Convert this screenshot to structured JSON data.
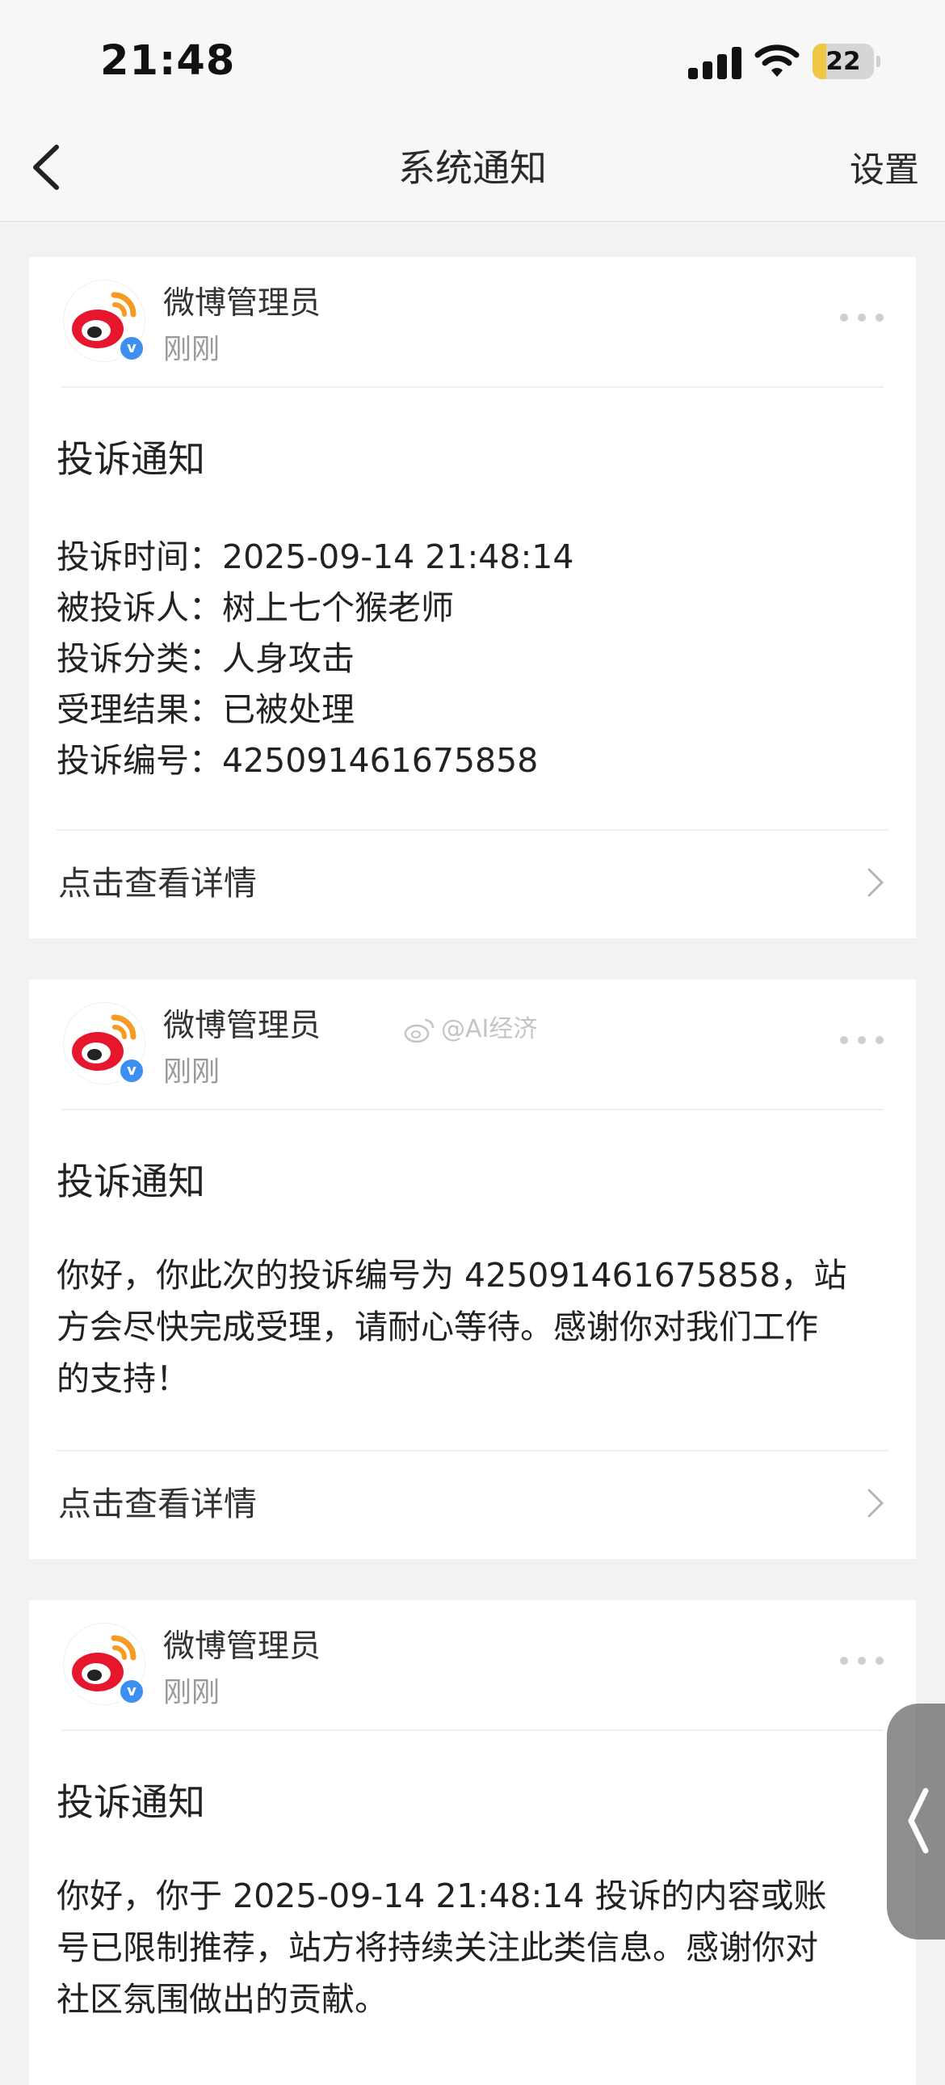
{
  "status_bar": {
    "time": "21:48",
    "battery_level": "22"
  },
  "nav": {
    "title": "系统通知",
    "settings_label": "设置"
  },
  "notices": [
    {
      "sender": "微博管理员",
      "time": "刚刚",
      "title": "投诉通知",
      "details": [
        {
          "label": "投诉时间：",
          "value": "2025-09-14 21:48:14"
        },
        {
          "label": "被投诉人：",
          "value": "树上七个猴老师"
        },
        {
          "label": "投诉分类：",
          "value": "人身攻击"
        },
        {
          "label": "受理结果：",
          "value": "已被处理"
        },
        {
          "label": "投诉编号：",
          "value": "425091461675858"
        }
      ],
      "link_label": "点击查看详情"
    },
    {
      "sender": "微博管理员",
      "time": "刚刚",
      "title": "投诉通知",
      "body_lines": [
        "你好，你此次的投诉编号为 425091461675858，站",
        "方会尽快完成受理，请耐心等待。感谢你对我们工作",
        "的支持！"
      ],
      "link_label": "点击查看详情"
    },
    {
      "sender": "微博管理员",
      "time": "刚刚",
      "title": "投诉通知",
      "body_lines": [
        "你好，你于 2025-09-14 21:48:14 投诉的内容或账",
        "号已限制推荐，站方将持续关注此类信息。感谢你对",
        "社区氛围做出的贡献。"
      ]
    }
  ],
  "watermark": "@AI经济",
  "colors": {
    "background": "#f2f2f2",
    "card": "#ffffff",
    "verified_blue": "#3d8ff0",
    "weibo_red": "#e6162d",
    "weibo_orange": "#f59a23",
    "battery_yellow": "#f2c744"
  },
  "icons": {
    "back": "chevron-left-icon",
    "more": "more-dots-icon",
    "detail": "chevron-right-icon",
    "avatar": "weibo-logo-icon",
    "badge": "verified-v-icon"
  }
}
